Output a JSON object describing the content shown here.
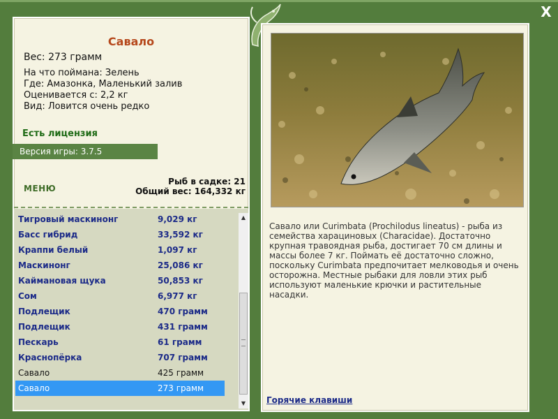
{
  "window": {
    "close_label": "X"
  },
  "fish": {
    "title": "Савало",
    "weight": "Вес: 273 грамм",
    "caught_on": "На что поймана: Зелень",
    "where": "Где: Амазонка, Маленький залив",
    "rated_from": "Оценивается с: 2,2 кг",
    "kind": "Вид: Ловится очень редко"
  },
  "license": "Есть лицензия",
  "version": "Версия игры: 3.7.5",
  "menu_label": "МЕНЮ",
  "keep": {
    "count": "Рыб в садке: 21",
    "total": "Общий вес: 164,332 кг"
  },
  "catch_list": [
    {
      "name": "Тигровый маскинонг",
      "weight": "9,029 кг",
      "style": "bold"
    },
    {
      "name": "Басс гибрид",
      "weight": "33,592 кг",
      "style": "bold"
    },
    {
      "name": "Краппи белый",
      "weight": "1,097 кг",
      "style": "bold"
    },
    {
      "name": "Маскинонг",
      "weight": "25,086 кг",
      "style": "bold"
    },
    {
      "name": "Каймановая щука",
      "weight": "50,853 кг",
      "style": "bold"
    },
    {
      "name": "Сом",
      "weight": "6,977 кг",
      "style": "bold"
    },
    {
      "name": "Подлещик",
      "weight": "470 грамм",
      "style": "bold"
    },
    {
      "name": "Подлещик",
      "weight": "431 грамм",
      "style": "bold"
    },
    {
      "name": "Пескарь",
      "weight": "61 грамм",
      "style": "bold"
    },
    {
      "name": "Краснопёрка",
      "weight": "707 грамм",
      "style": "bold"
    },
    {
      "name": "Савало",
      "weight": "425 грамм",
      "style": "plain"
    },
    {
      "name": "Савало",
      "weight": "273 грамм",
      "style": "selected"
    }
  ],
  "description": "Савало или Curimbata (Prochilodus lineatus) - рыба из семейства харациновых (Characidae). Достаточно крупная травоядная рыба, достигает 70 см длины и массы более 7 кг. Поймать её достаточно сложно, поскольку Curimbata предпочитает мелководья и очень осторожна. Местные рыбаки для ловли этих рыб используют маленькие крючки и растительные насадки.",
  "hotkeys_label": "Горячие клавиши",
  "colors": {
    "frame": "#537d3d",
    "panel": "#f5f3e2",
    "title": "#b5471b",
    "list_link": "#1b2a88",
    "selection": "#3398f4"
  }
}
